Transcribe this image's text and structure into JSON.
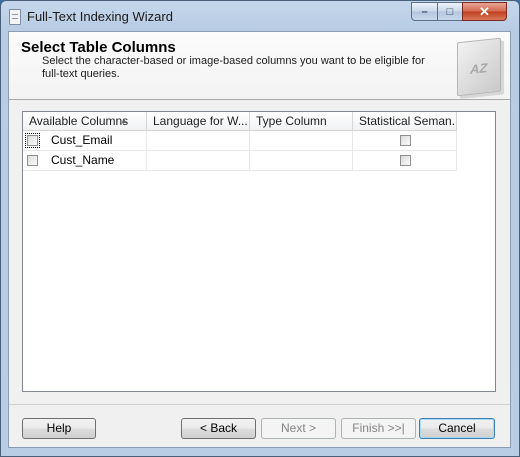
{
  "window": {
    "title": "Full-Text Indexing Wizard",
    "controls": {
      "minimize": "–",
      "maximize": "□",
      "close": "✕"
    }
  },
  "header": {
    "title": "Select Table Columns",
    "description": "Select the character-based or image-based columns you want to be eligible for full-text queries.",
    "graphic_text": "AZ"
  },
  "grid": {
    "columns": [
      "Available Columns",
      "Language for W...",
      "Type Column",
      "Statistical Seman..."
    ],
    "sort_indicator": "▲",
    "rows": [
      {
        "selected": false,
        "name": "Cust_Email",
        "language": "",
        "type_column": "",
        "statistical_semantics": false
      },
      {
        "selected": false,
        "name": "Cust_Name",
        "language": "",
        "type_column": "",
        "statistical_semantics": false
      }
    ]
  },
  "buttons": {
    "help": "Help",
    "back": "< Back",
    "next": "Next >",
    "finish": "Finish >>|",
    "cancel": "Cancel"
  },
  "icons": {
    "app": "wizard-document-icon",
    "header_graphic": "az-book-icon"
  }
}
